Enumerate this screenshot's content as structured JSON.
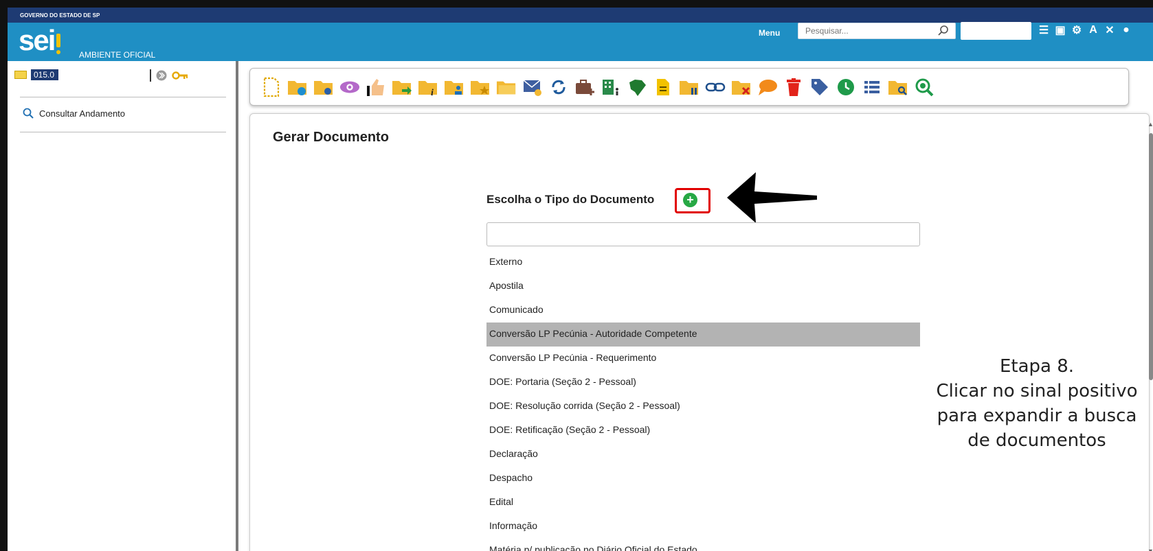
{
  "header": {
    "gov_label": "GOVERNO DO ESTADO DE SP",
    "logo_text": "sei",
    "env_label": "AMBIENTE OFICIAL",
    "menu_label": "Menu",
    "search_placeholder": "Pesquisar...",
    "brand_color": "#1f8fc4",
    "gov_bar_color": "#1e3b73",
    "icons": [
      "list-icon",
      "card-icon",
      "settings-icon",
      "font-size-icon",
      "tools-icon",
      "user-icon"
    ]
  },
  "left_panel": {
    "process_number": "015.0",
    "consult_label": "Consultar Andamento"
  },
  "toolbar": {
    "icons": [
      "new-document-icon",
      "folder-sync-icon",
      "folder-settings-icon",
      "eye-icon",
      "thumbs-up-icon",
      "folder-send-icon",
      "folder-info-icon",
      "folder-user-icon",
      "folder-star-icon",
      "folder-open-icon",
      "mail-icon",
      "refresh-icon",
      "briefcase-add-icon",
      "building-icon",
      "brazil-map-icon",
      "document-yellow-icon",
      "folder-pause-icon",
      "link-icon",
      "folder-close-icon",
      "comment-icon",
      "trash-icon",
      "tag-icon",
      "clock-icon",
      "list-icon",
      "folder-search-icon",
      "zoom-icon"
    ]
  },
  "main": {
    "page_title": "Gerar Documento",
    "choose_title": "Escolha o Tipo do Documento",
    "plus_symbol": "+",
    "doc_types": [
      "Externo",
      "Apostila",
      "Comunicado",
      "Conversão LP Pecúnia - Autoridade Competente",
      "Conversão LP Pecúnia - Requerimento",
      "DOE: Portaria (Seção 2 - Pessoal)",
      "DOE: Resolução corrida (Seção 2 - Pessoal)",
      "DOE: Retificação (Seção 2 - Pessoal)",
      "Declaração",
      "Despacho",
      "Edital",
      "Informação",
      "Matéria p/ publicação no Diário Oficial do Estado"
    ],
    "selected_index": 3
  },
  "annotation": {
    "line1": "Etapa 8.",
    "line2": "Clicar no sinal positivo",
    "line3": "para expandir a busca",
    "line4": "de documentos"
  }
}
